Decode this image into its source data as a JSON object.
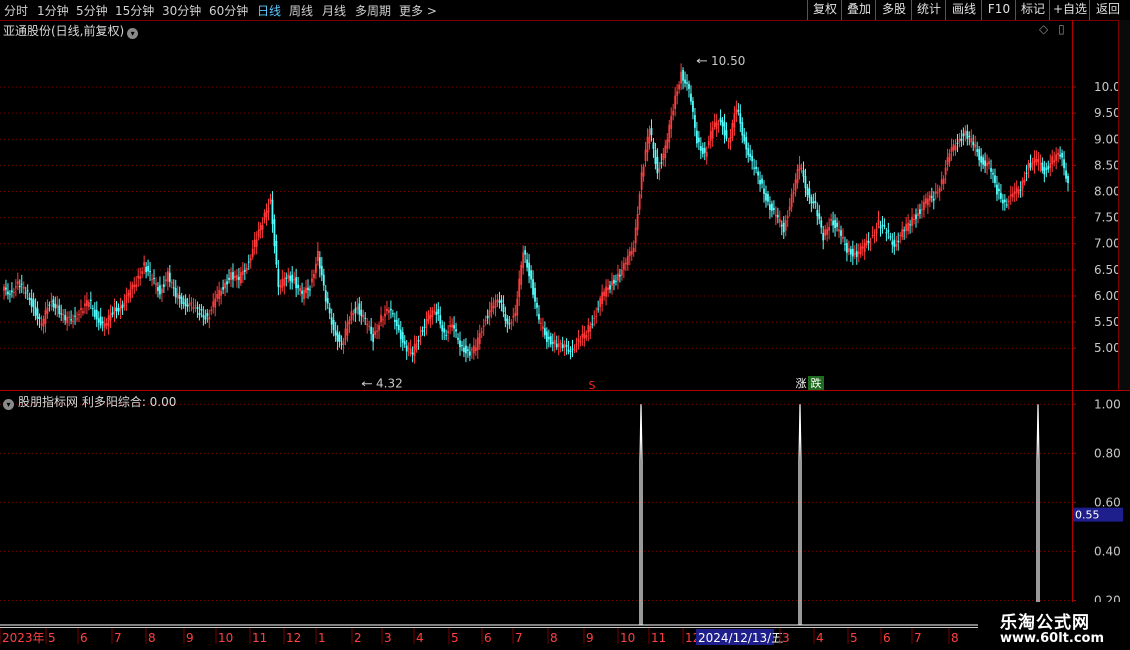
{
  "toolbar": {
    "period_tabs": [
      "分时",
      "1分钟",
      "5分钟",
      "15分钟",
      "30分钟",
      "60分钟",
      "日线",
      "周线",
      "月线",
      "多周期",
      "更多"
    ],
    "active_tab": "日线",
    "right_buttons": [
      "复权",
      "叠加",
      "多股",
      "统计",
      "画线",
      "F10",
      "标记",
      "+自选",
      "返回"
    ]
  },
  "main_panel": {
    "title": "亚通股份(日线,前复权)",
    "high_label": "10.50",
    "low_label": "4.32",
    "signal_s": "S",
    "signal_zhang": "涨",
    "signal_die": "跌"
  },
  "indicator_panel": {
    "title": "股朋指标网 利多阳综合: 0.00",
    "cursor_value": "0.55"
  },
  "date_axis": {
    "labels": [
      "2023年",
      "5",
      "6",
      "7",
      "8",
      "9",
      "10",
      "11",
      "12",
      "1",
      "2",
      "3",
      "4",
      "5",
      "6",
      "7",
      "8",
      "9",
      "10",
      "11",
      "12",
      "2024/12/13/五",
      "3",
      "4",
      "5",
      "6",
      "7",
      "8"
    ],
    "cursor_date": "2024/12/13/五"
  },
  "watermark": {
    "line1": "乐淘公式网",
    "line2": "www.60lt.com"
  },
  "colors": {
    "up": "#ff3b3b",
    "down": "#54ffff",
    "grid": "#7a0000",
    "axis_text": "#c8c8c8",
    "cursor_bg": "#1e1e8c"
  },
  "chart_data": [
    {
      "type": "candlestick",
      "title": "亚通股份(日线,前复权)",
      "ylim": [
        4.2,
        10.9
      ],
      "y_ticks": [
        5.0,
        5.5,
        6.0,
        6.5,
        7.0,
        7.5,
        8.0,
        8.5,
        9.0,
        9.5,
        10.0
      ],
      "close_path": [
        6.1,
        6.2,
        6.1,
        5.8,
        5.4,
        5.9,
        5.8,
        5.5,
        5.6,
        5.7,
        5.9,
        5.6,
        5.4,
        5.7,
        5.8,
        6.0,
        6.3,
        6.6,
        6.3,
        6.1,
        6.4,
        6.0,
        5.9,
        5.8,
        5.7,
        5.6,
        5.9,
        6.2,
        6.4,
        6.3,
        6.6,
        7.0,
        7.4,
        7.9,
        6.1,
        6.4,
        6.3,
        6.0,
        6.2,
        6.8,
        5.9,
        5.4,
        5.0,
        5.6,
        5.8,
        5.5,
        5.2,
        5.6,
        5.7,
        5.5,
        5.0,
        4.9,
        5.3,
        5.6,
        5.7,
        5.3,
        5.4,
        5.1,
        4.9,
        5.0,
        5.5,
        5.8,
        5.9,
        5.5,
        5.6,
        6.9,
        6.3,
        5.5,
        5.2,
        5.1,
        5.0,
        5.0,
        5.1,
        5.3,
        5.6,
        6.0,
        6.2,
        6.4,
        6.6,
        7.0,
        8.3,
        9.2,
        8.4,
        8.8,
        9.6,
        10.3,
        9.9,
        9.0,
        8.7,
        9.2,
        9.4,
        8.9,
        9.6,
        9.0,
        8.5,
        8.2,
        7.8,
        7.5,
        7.3,
        7.9,
        8.5,
        8.0,
        7.7,
        7.1,
        7.5,
        7.2,
        6.9,
        6.8,
        6.9,
        7.1,
        7.4,
        7.2,
        7.0,
        7.2,
        7.4,
        7.6,
        7.8,
        7.9,
        8.2,
        8.7,
        9.0,
        9.1,
        8.9,
        8.6,
        8.5,
        8.0,
        7.8,
        7.9,
        8.1,
        8.5,
        8.6,
        8.4,
        8.6,
        8.7,
        8.2
      ],
      "annotations": {
        "high": 10.5,
        "low": 4.32
      }
    },
    {
      "type": "line",
      "title": "股朋指标网 利多阳综合: 0.00",
      "ylim": [
        0.1,
        1.05
      ],
      "y_ticks": [
        0.2,
        0.4,
        0.6,
        0.8,
        1.0
      ],
      "spikes": [
        {
          "date": "2024/10",
          "value": 1.0
        },
        {
          "date": "2025/3",
          "value": 1.0
        },
        {
          "date": "2025/9",
          "value": 1.0
        }
      ]
    }
  ]
}
